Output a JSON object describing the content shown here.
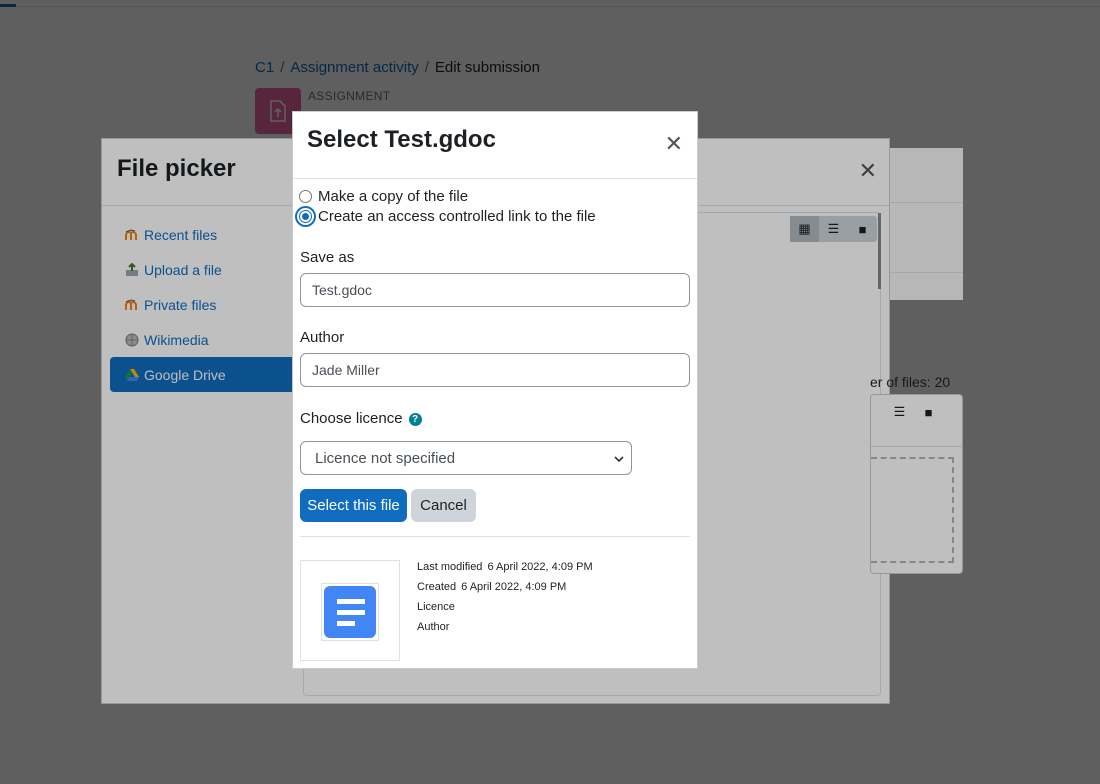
{
  "breadcrumb": {
    "items": [
      "C1",
      "Assignment activity"
    ],
    "current": "Edit submission",
    "separator": "/"
  },
  "activity": {
    "type_label": "ASSIGNMENT",
    "icon": "assignment-upload-icon",
    "accent_color": "#eb66a2"
  },
  "file_picker": {
    "title": "File picker",
    "close_icon": "close-icon",
    "repositories": [
      {
        "label": "Recent files",
        "icon": "moodle-icon"
      },
      {
        "label": "Upload a file",
        "icon": "upload-icon"
      },
      {
        "label": "Private files",
        "icon": "moodle-icon"
      },
      {
        "label": "Wikimedia",
        "icon": "wikimedia-icon"
      },
      {
        "label": "Google Drive",
        "icon": "google-drive-icon"
      }
    ],
    "active_repository": "Google Drive",
    "view_buttons": [
      "grid-view-icon",
      "list-view-icon",
      "folder-view-icon"
    ]
  },
  "background_form": {
    "max_files_text": "er of files: 20"
  },
  "select_dialog": {
    "title": "Select Test.gdoc",
    "options": [
      {
        "label": "Make a copy of the file",
        "checked": false
      },
      {
        "label": "Create an access controlled link to the file",
        "checked": true
      }
    ],
    "save_as_label": "Save as",
    "save_as_value": "Test.gdoc",
    "author_label": "Author",
    "author_value": "Jade Miller",
    "licence_label": "Choose licence",
    "licence_value": "Licence not specified",
    "select_button": "Select this file",
    "cancel_button": "Cancel",
    "meta": {
      "last_modified_label": "Last modified",
      "last_modified_value": "6 April 2022, 4:09 PM",
      "created_label": "Created",
      "created_value": "6 April 2022, 4:09 PM",
      "licence_label": "Licence",
      "author_label": "Author"
    },
    "primary_color": "#0f6cbf"
  }
}
